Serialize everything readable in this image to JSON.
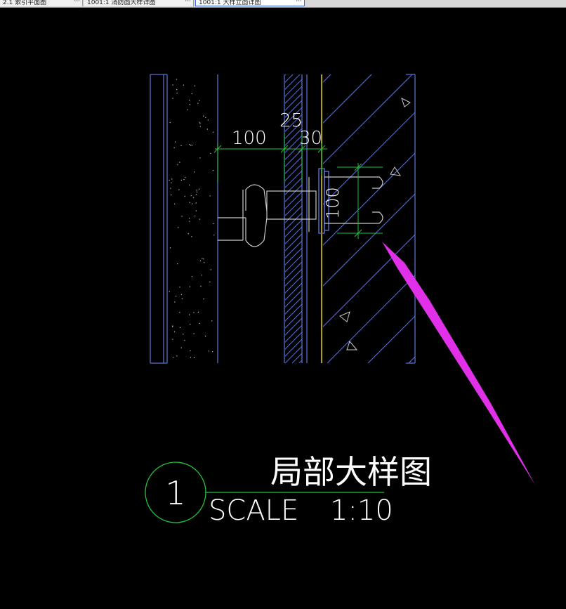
{
  "tabs": [
    {
      "label": "2.1 索引平面图",
      "more": "···",
      "active": false
    },
    {
      "label": "1001:1 消防面大样详图",
      "more": "···",
      "active": false
    },
    {
      "label": "1001:1 大样立面详图",
      "more": "···",
      "active": true
    }
  ],
  "drawing": {
    "dimensions": {
      "dim_100_horizontal": "100",
      "dim_25": "25",
      "dim_30": "30",
      "dim_100_vertical": "100"
    },
    "title_block": {
      "detail_number": "1",
      "title": "局部大样图",
      "scale_label": "SCALE",
      "scale_value": "1:10"
    }
  },
  "colors": {
    "background": "#000000",
    "wall_lines": "#5a6fc8",
    "dimension_lines": "#22c23a",
    "dimension_text": "#ffffff",
    "panel_line": "#e6d800",
    "annotation_arrow": "#e030e8",
    "title_circle": "#22c23a"
  }
}
